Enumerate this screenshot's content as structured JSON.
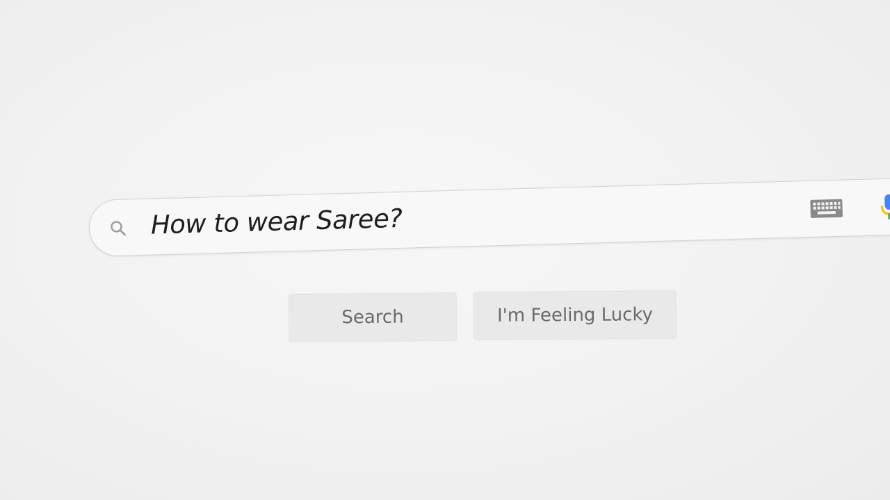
{
  "search": {
    "query": "How to wear Saree?",
    "icons": {
      "search": "search-icon",
      "keyboard": "keyboard-icon",
      "voice": "microphone-icon"
    }
  },
  "buttons": {
    "search_label": "Search",
    "lucky_label": "I'm Feeling Lucky"
  },
  "colors": {
    "background": "#f2f2f2",
    "search_box_border": "#d2d2d2",
    "button_background": "#e9e9e9",
    "button_text": "#6a6a6a",
    "mic_blue": "#4285f4",
    "mic_red": "#ea4335",
    "mic_yellow": "#fbbc05"
  }
}
